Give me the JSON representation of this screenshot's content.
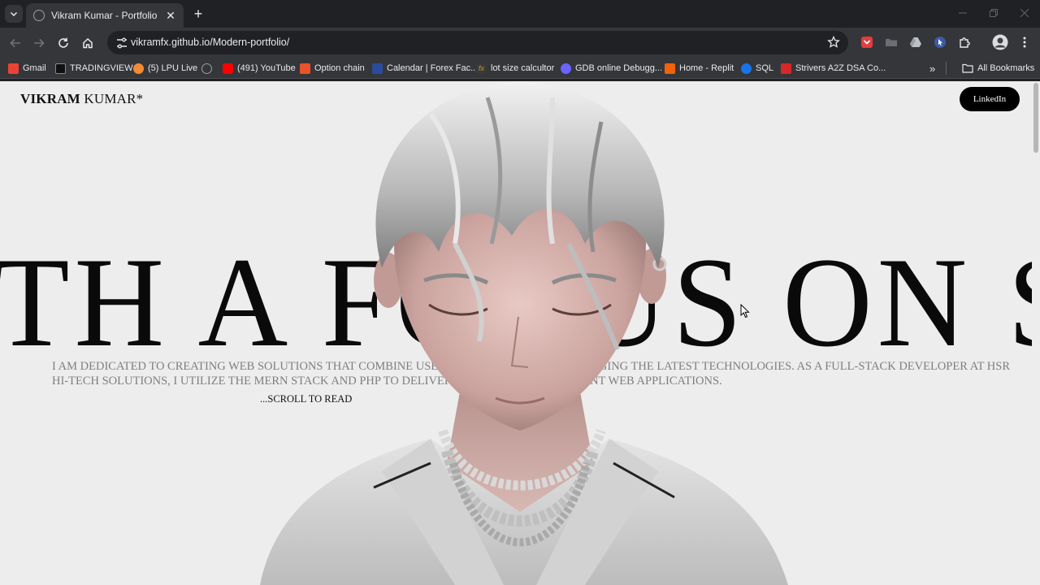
{
  "browser": {
    "tab": {
      "title": "Vikram Kumar - Portfolio"
    },
    "address": {
      "url": "vikramfx.github.io/Modern-portfolio/"
    },
    "bookmarks": [
      {
        "label": "Gmail",
        "icon": "gmail-icon",
        "color": "#ea4335"
      },
      {
        "label": "TRADINGVIEW",
        "icon": "tradingview-icon",
        "color": "#111111"
      },
      {
        "label": "(5) LPU Live",
        "icon": "lpu-icon",
        "color": "#f28b34"
      },
      {
        "label": "",
        "icon": "globe-icon",
        "color": "#9aa0a6"
      },
      {
        "label": "(491) YouTube",
        "icon": "youtube-icon",
        "color": "#ff0000"
      },
      {
        "label": "Option chain",
        "icon": "option-chain-icon",
        "color": "#e8532b"
      },
      {
        "label": "Calendar | Forex Fac...",
        "icon": "calendar-icon",
        "color": "#2b4c9b"
      },
      {
        "label": "lot size calcultor",
        "icon": "fx-icon",
        "color": "#c99b2a"
      },
      {
        "label": "GDB online Debugg...",
        "icon": "gdb-icon",
        "color": "#6c63ff"
      },
      {
        "label": "Home - Replit",
        "icon": "replit-icon",
        "color": "#f26207"
      },
      {
        "label": "SQL",
        "icon": "sql-icon",
        "color": "#1a73e8"
      },
      {
        "label": "Strivers A2Z DSA Co...",
        "icon": "tuf-icon",
        "color": "#d62828"
      }
    ],
    "all_bookmarks": "All Bookmarks"
  },
  "page": {
    "logo_bold": "VIKRAM",
    "logo_rest": " KUMAR*",
    "linkedin": "LinkedIn",
    "marquee": "TH A FOCUS ON S",
    "bio": "I am dedicated to creating web solutions that combine user-centric design, leveraging the latest technologies. As a full-stack developer at HSR Hi-Tech Solutions, I utilize the MERN stack and PHP to deliver scalable and efficient web applications.",
    "scroll_cta": "...SCROLL TO READ"
  }
}
